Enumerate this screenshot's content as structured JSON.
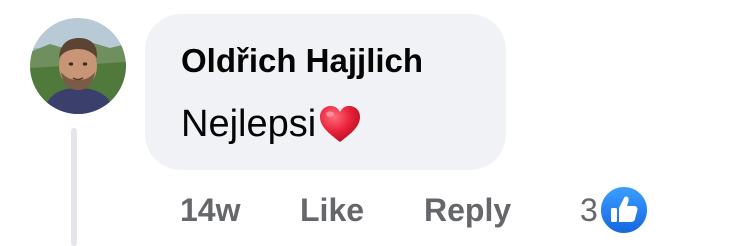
{
  "comment": {
    "author": "Oldřich Hajjlich",
    "text": "Nejlepsi",
    "emoji": "red-heart"
  },
  "actions": {
    "timestamp": "14w",
    "like_label": "Like",
    "reply_label": "Reply"
  },
  "reactions": {
    "count": "3",
    "type": "like"
  },
  "colors": {
    "bubble_bg": "#f0f2f5",
    "text": "#050505",
    "meta_text": "#65676b",
    "like_blue": "#1877f2",
    "heart_red": "#e0245e",
    "thread_line": "#e4e6eb"
  }
}
